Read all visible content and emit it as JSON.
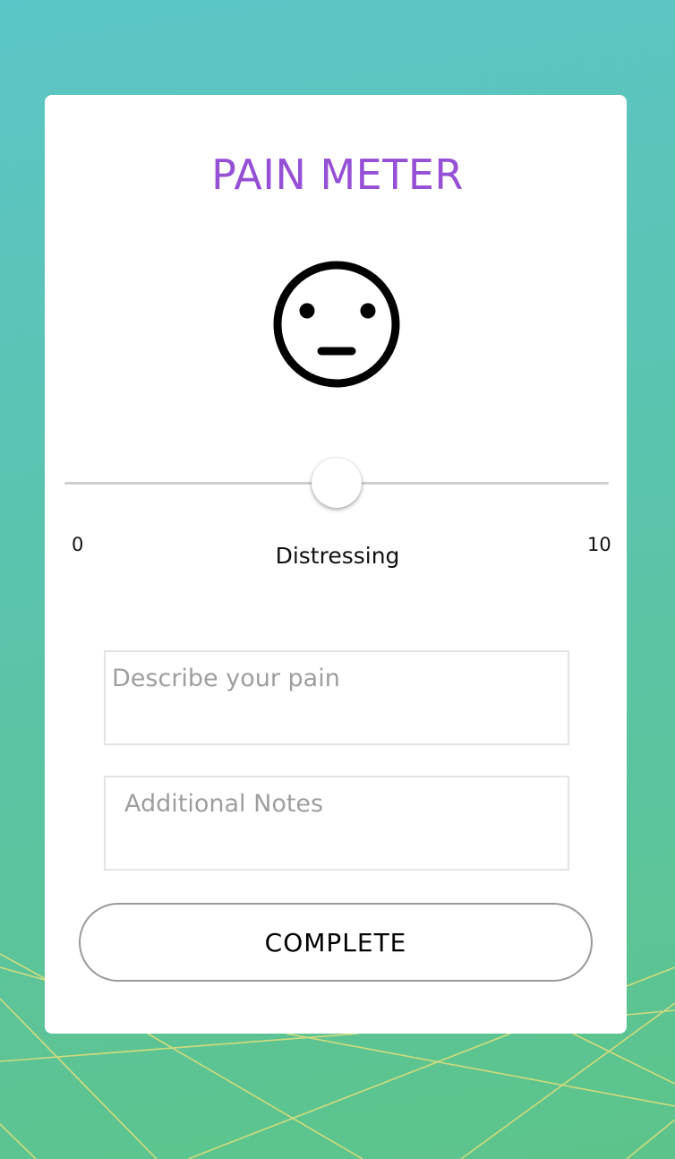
{
  "colors": {
    "title": "#9550d6",
    "face": "#000000",
    "background_top": "#5cc5c7",
    "background_bottom": "#5cc48a",
    "decor_lines": "#e8e27a"
  },
  "header": {
    "title": "PAIN METER"
  },
  "face_icon": "neutral-face-icon",
  "slider": {
    "min_label": "0",
    "max_label": "10",
    "value": 5,
    "level_label": "Distressing"
  },
  "describe_field": {
    "placeholder": "Describe your pain",
    "value": ""
  },
  "notes_field": {
    "placeholder": "Additional Notes",
    "value": ""
  },
  "complete_button": {
    "label": "COMPLETE"
  }
}
